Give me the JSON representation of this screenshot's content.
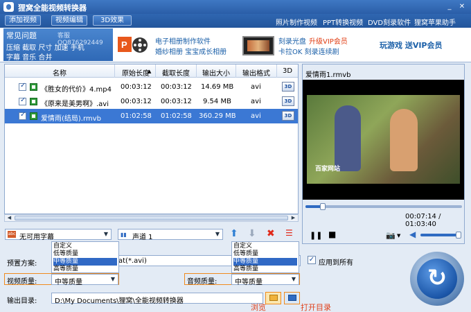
{
  "window": {
    "title": "狸窝全能视频转换器",
    "minimize": "_",
    "close": "✕"
  },
  "toolbar": {
    "add_video": "添加视频",
    "edit_video": "视频编辑",
    "effect_3d": "3D效果",
    "links": [
      "照片制作视频",
      "PPT转换视频",
      "DVD刻录软件",
      "狸窝苹果助手"
    ]
  },
  "faq": {
    "title": "常见问题",
    "qq": "客服QQ876292449",
    "line1": "压缩  截取  尺寸  加速  手机",
    "line2": "字幕  音乐  合并"
  },
  "promo": {
    "ppt_line1": "电子相册制作软件",
    "ppt_line2": "婚纱相册  宝宝成长相册",
    "dvd_line1": "刻录光盘",
    "dvd_vip": "升级VIP会员",
    "dvd_line2": "卡拉OK  刻录连续剧",
    "play": "玩游戏  送VIP会员"
  },
  "table": {
    "headers": [
      "名称",
      "原始长度",
      "截取长度",
      "输出大小",
      "输出格式",
      "3D"
    ],
    "rows": [
      {
        "name": "《胜女的代价》4.mp4",
        "orig": "00:03:12",
        "cut": "00:03:12",
        "size": "14.69 MB",
        "format": "avi",
        "d3": "3D"
      },
      {
        "name": "《原来是美男啊》.avi",
        "orig": "00:03:12",
        "cut": "00:03:12",
        "size": "9.54 MB",
        "format": "avi",
        "d3": "3D"
      },
      {
        "name": "爱情雨(结局).rmvb",
        "orig": "01:02:58",
        "cut": "01:02:58",
        "size": "360.29 MB",
        "format": "avi",
        "d3": "3D"
      }
    ]
  },
  "preview": {
    "filename": "爱情雨1.rmvb",
    "watermark": "百家网站",
    "current": "00:07:14",
    "total": "01:03:40",
    "time_sep": " / ",
    "progress": 0.11,
    "volume": 0.95
  },
  "subtitle": {
    "value": "无可用字幕"
  },
  "audio_track": {
    "value": "声道 1"
  },
  "preset": {
    "label": "预置方案:",
    "value_suffix": "at(*.avi)"
  },
  "video_quality": {
    "label": "视频质量:",
    "value": "中等质量",
    "options": [
      "自定义",
      "低等质量",
      "中等质量",
      "高等质量"
    ],
    "highlighted": "中等质量"
  },
  "audio_quality": {
    "label": "音频质量:",
    "value": "中等质量",
    "options": [
      "自定义",
      "低等质量",
      "中等质量",
      "高等质量"
    ],
    "highlighted": "中等质量"
  },
  "apply_all": {
    "label": "应用到所有",
    "checked": true
  },
  "output": {
    "label": "输出目录:",
    "path": "D:\\My Documents\\狸窝\\全能视频转换器",
    "browse_label": "浏览",
    "open_label": "打开目录"
  }
}
